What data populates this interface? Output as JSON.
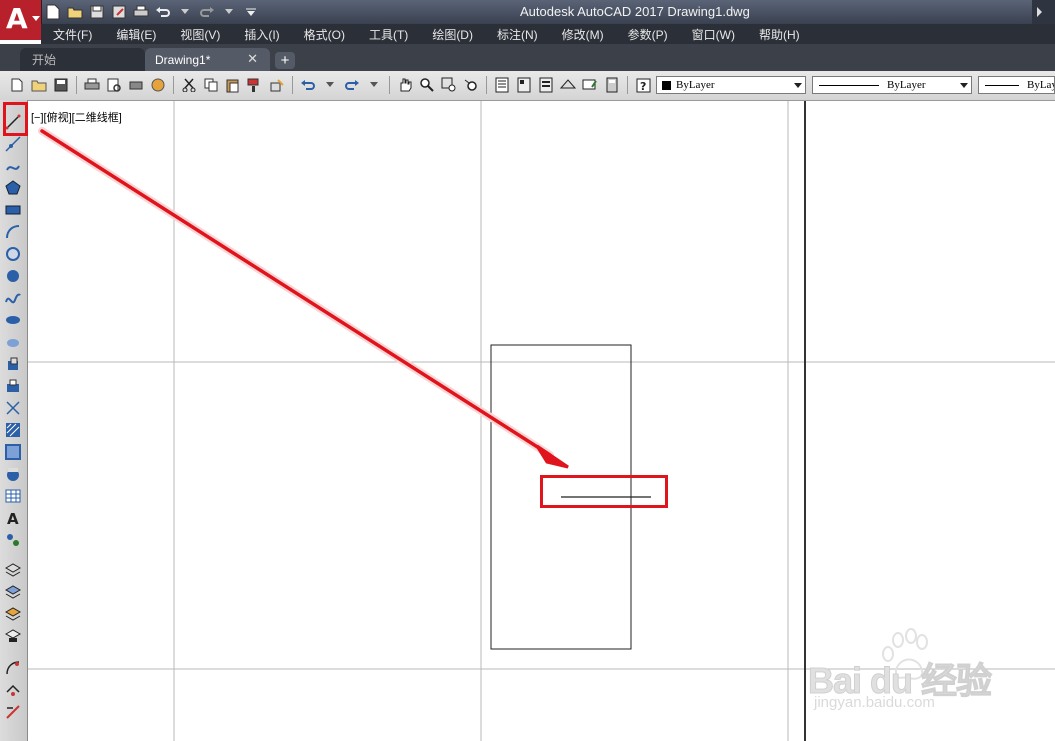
{
  "app": {
    "title": "Autodesk AutoCAD 2017    Drawing1.dwg",
    "logo_letter": "A"
  },
  "menu": [
    "文件(F)",
    "编辑(E)",
    "视图(V)",
    "插入(I)",
    "格式(O)",
    "工具(T)",
    "绘图(D)",
    "标注(N)",
    "修改(M)",
    "参数(P)",
    "窗口(W)",
    "帮助(H)"
  ],
  "tabs": {
    "start": "开始",
    "drawing": "Drawing1*",
    "close_glyph": "✕",
    "add_glyph": "+"
  },
  "toolbar": {
    "color_combo": "ByLayer",
    "linetype_combo": "ByLayer",
    "lineweight_combo": "ByLayer"
  },
  "viewport": {
    "label": "[−][俯视][二维线框]"
  },
  "left_tools": [
    "line-icon",
    "construction-line-icon",
    "polyline-icon",
    "polygon-icon",
    "rectangle-icon",
    "arc-icon",
    "circle-icon",
    "revision-cloud-icon",
    "spline-icon",
    "ellipse-icon",
    "ellipse-arc-icon",
    "insert-block-icon",
    "make-block-icon",
    "point-icon",
    "hatch-icon",
    "gradient-icon",
    "region-icon",
    "table-icon",
    "multiline-text-icon",
    "add-selected-icon",
    "layer-icon-1",
    "layer-icon-2",
    "layer-icon-3",
    "layer-icon-4",
    "modify-icon-1",
    "modify-icon-2",
    "modify-icon-3"
  ],
  "watermark": {
    "brand": "Bai du 经验",
    "url": "jingyan.baidu.com"
  },
  "colors": {
    "annotation_red": "#e0141d",
    "title_bg": "#3a4150",
    "logo_red": "#b8212c"
  }
}
